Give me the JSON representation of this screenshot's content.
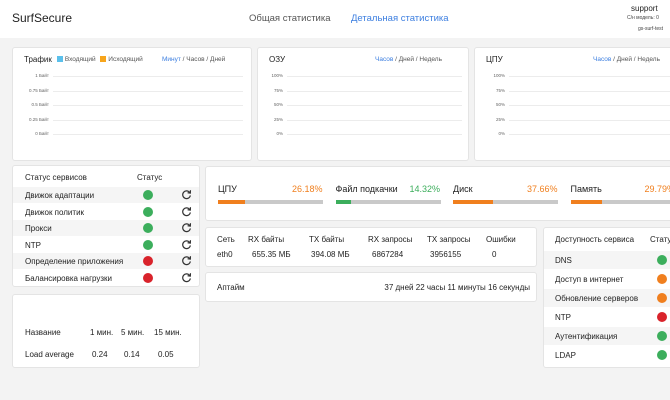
{
  "app": {
    "title": "SurfSecure"
  },
  "nav": {
    "general": "Общая статистика",
    "detail": "Детальная статистика"
  },
  "user": {
    "name": "support",
    "line2": "С/н модель: 0",
    "line3": "gs-surf-test"
  },
  "traffic": {
    "title": "Трафик",
    "legend_in": "Входящий",
    "legend_out": "Исходящий",
    "color_in": "#5bc0eb",
    "color_out": "#f7a51c",
    "period_sel": "Минут",
    "period_rest": " / Часов / Дней",
    "ticks": [
      "1 Байт",
      "0.75 Байт",
      "0.5 Байт",
      "0.25 Байт",
      "0 Байт"
    ]
  },
  "ram": {
    "title": "ОЗУ",
    "period_sel": "Часов",
    "period_rest": " / Дней / Недель",
    "ticks": [
      "100%",
      "75%",
      "50%",
      "25%",
      "0%"
    ]
  },
  "cpu_chart": {
    "title": "ЦПУ",
    "period_sel": "Часов",
    "period_rest": " / Дней / Недель",
    "ticks": [
      "100%",
      "75%",
      "50%",
      "25%",
      "0%"
    ]
  },
  "services": {
    "header_name": "Статус сервисов",
    "header_status": "Статус",
    "items": [
      {
        "name": "Движок адаптации",
        "status": "green"
      },
      {
        "name": "Движок политик",
        "status": "green"
      },
      {
        "name": "Прокси",
        "status": "green"
      },
      {
        "name": "NTP",
        "status": "green"
      },
      {
        "name": "Определение приложения",
        "status": "red"
      },
      {
        "name": "Балансировка нагрузки",
        "status": "red"
      }
    ]
  },
  "load": {
    "headers": [
      "Название",
      "1 мин.",
      "5 мин.",
      "15 мин."
    ],
    "row": [
      "Load average",
      "0.24",
      "0.14",
      "0.05"
    ]
  },
  "meters": [
    {
      "label": "ЦПУ",
      "value": "26.18%",
      "percent": 26.18,
      "color": "#f07f1e",
      "cls": "val-o"
    },
    {
      "label": "Файл подкачки",
      "value": "14.32%",
      "percent": 14.32,
      "color": "#3cae5c",
      "cls": "val-g"
    },
    {
      "label": "Диск",
      "value": "37.66%",
      "percent": 37.66,
      "color": "#f07f1e",
      "cls": "val-o"
    },
    {
      "label": "Память",
      "value": "29.79%",
      "percent": 29.79,
      "color": "#f07f1e",
      "cls": "val-o"
    }
  ],
  "network": {
    "headers": [
      "Сеть",
      "RX байты",
      "TX байты",
      "RX запросы",
      "TX запросы",
      "Ошибки"
    ],
    "row": [
      "eth0",
      "655.35 МБ",
      "394.08 МБ",
      "6867284",
      "3956155",
      "0"
    ]
  },
  "uptime": {
    "label": "Аптайм",
    "value": "37 дней 22 часы 11 минуты 16 секунды"
  },
  "availability": {
    "header_name": "Доступность сервиса",
    "header_status": "Статус",
    "items": [
      {
        "name": "DNS",
        "status": "green"
      },
      {
        "name": "Доступ в интернет",
        "status": "orange"
      },
      {
        "name": "Обновление серверов",
        "status": "orange"
      },
      {
        "name": "NTP",
        "status": "red"
      },
      {
        "name": "Аутентификация",
        "status": "green"
      },
      {
        "name": "LDAP",
        "status": "green"
      }
    ]
  }
}
